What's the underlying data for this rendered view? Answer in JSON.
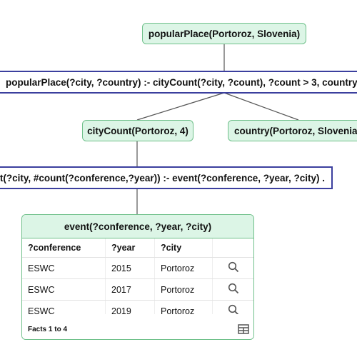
{
  "nodes": {
    "root_fact": "popularPlace(Portoroz, Slovenia)",
    "rule_popular": "popularPlace(?city, ?country) :- cityCount(?city, ?count), ?count > 3, country(?city, ?country) .",
    "fact_citycount": "cityCount(Portoroz, 4)",
    "fact_country": "country(Portoroz, Slovenia)",
    "rule_citycount": "cityCount(?city, #count(?conference,?year)) :- event(?conference, ?year, ?city) ."
  },
  "panel": {
    "title": "event(?conference, ?year, ?city)",
    "columns": [
      "?conference",
      "?year",
      "?city"
    ],
    "rows": [
      {
        "conference": "ESWC",
        "year": "2015",
        "city": "Portoroz"
      },
      {
        "conference": "ESWC",
        "year": "2017",
        "city": "Portoroz"
      },
      {
        "conference": "ESWC",
        "year": "2019",
        "city": "Portoroz"
      }
    ],
    "footer": "Facts 1 to 4",
    "row_action_icon": "search-icon",
    "footer_icon": "table-grid-icon"
  },
  "colors": {
    "fact_fill": "#dcf5e6",
    "fact_border": "#6fc08a",
    "rule_border": "#3b3f9e",
    "edge": "#555555"
  }
}
